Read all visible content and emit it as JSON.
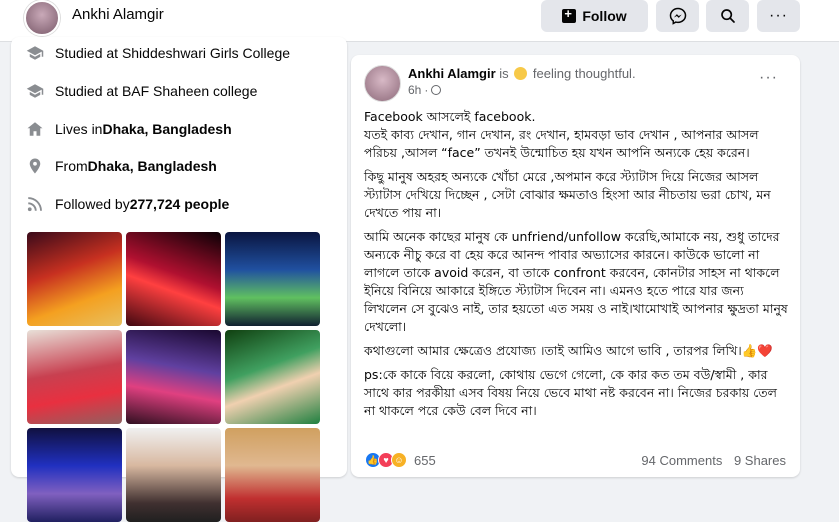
{
  "header": {
    "profile_name": "Ankhi Alamgir",
    "follow_label": "Follow",
    "messenger_icon": "messenger-icon",
    "search_icon": "search-icon",
    "more_icon": "more-icon"
  },
  "intro": {
    "items": [
      {
        "icon": "graduation-cap-icon",
        "text": "Studied at Shiddeshwari Girls College",
        "bold": ""
      },
      {
        "icon": "graduation-cap-icon",
        "text": "Studied at BAF Shaheen college",
        "bold": ""
      },
      {
        "icon": "home-icon",
        "text": "Lives in ",
        "bold": "Dhaka, Bangladesh"
      },
      {
        "icon": "location-pin-icon",
        "text": "From ",
        "bold": "Dhaka, Bangladesh"
      },
      {
        "icon": "rss-icon",
        "text": "Followed by ",
        "bold": "277,724 people"
      }
    ]
  },
  "photos": {
    "count": 9
  },
  "post": {
    "author": "Ankhi Alamgir",
    "is_text": "is",
    "feeling": "feeling thoughtful.",
    "time": "6h",
    "more": "···",
    "paragraphs": [
      "Facebook আসলেই facebook.\nযতই কাব্য দেখান, গান দেখান, রং দেখান, হামবড়া ভাব দেখান , আপনার আসল পরিচয় ,আসল “face” তখনই উন্মোচিত হয় যখন আপনি অন্যকে হেয় করেন।",
      "কিছু মানুষ অহরহ অন্যকে খোঁচা মেরে ,অপমান করে স্ট্যাটাস দিয়ে নিজের আসল স্ট্যাটাস দেখিয়ে দিচ্ছেন , সেটা বোঝার ক্ষমতাও হিংসা আর নীচতায় ভরা চোখ, মন দেখতে পায় না।",
      "আমি অনেক কাছের মানুষ কে unfriend/unfollow করেছি,আমাকে নয়, শুধু তাদের অন্যকে নীচু করে বা হেয় করে আনন্দ পাবার অভ্যাসের কারনে। কাউকে ভালো না লাগলে তাকে avoid করেন, বা তাকে confront করবেন, কোনটার সাহস না থাকলে ইনিয়ে বিনিয়ে আকারে ইঙ্গিতে স্ট্যাটাস দিবেন না। এমনও হতে পারে যার জন্য লিখলেন সে বুঝেও নাই, তার হয়তো এত সময় ও নাই।খামোখাই আপনার ক্ষুদ্রতা মানুষ দেখলো।",
      " কথাগুলো আমার ক্ষেত্রেও প্রযোজ্য ।তাই আমিও আগে ভাবি , তারপর লিখি।👍❤️",
      "ps:কে কাকে বিয়ে করলো, কোথায় ভেগে গেলো, কে কার কত তম বউ/স্বামী , কার সাথে কার পরকীয়া এসব বিষয় নিয়ে ভেবে মাথা নষ্ট করবেন না। নিজের চরকায় তেল না থাকলে পরে কেউ বেল দিবে না।"
    ],
    "reaction_count": "655",
    "comments": "94 Comments",
    "shares": "9 Shares"
  },
  "colors": {
    "like": "#1877f2",
    "love": "#f33e58",
    "care": "#f7b125"
  }
}
